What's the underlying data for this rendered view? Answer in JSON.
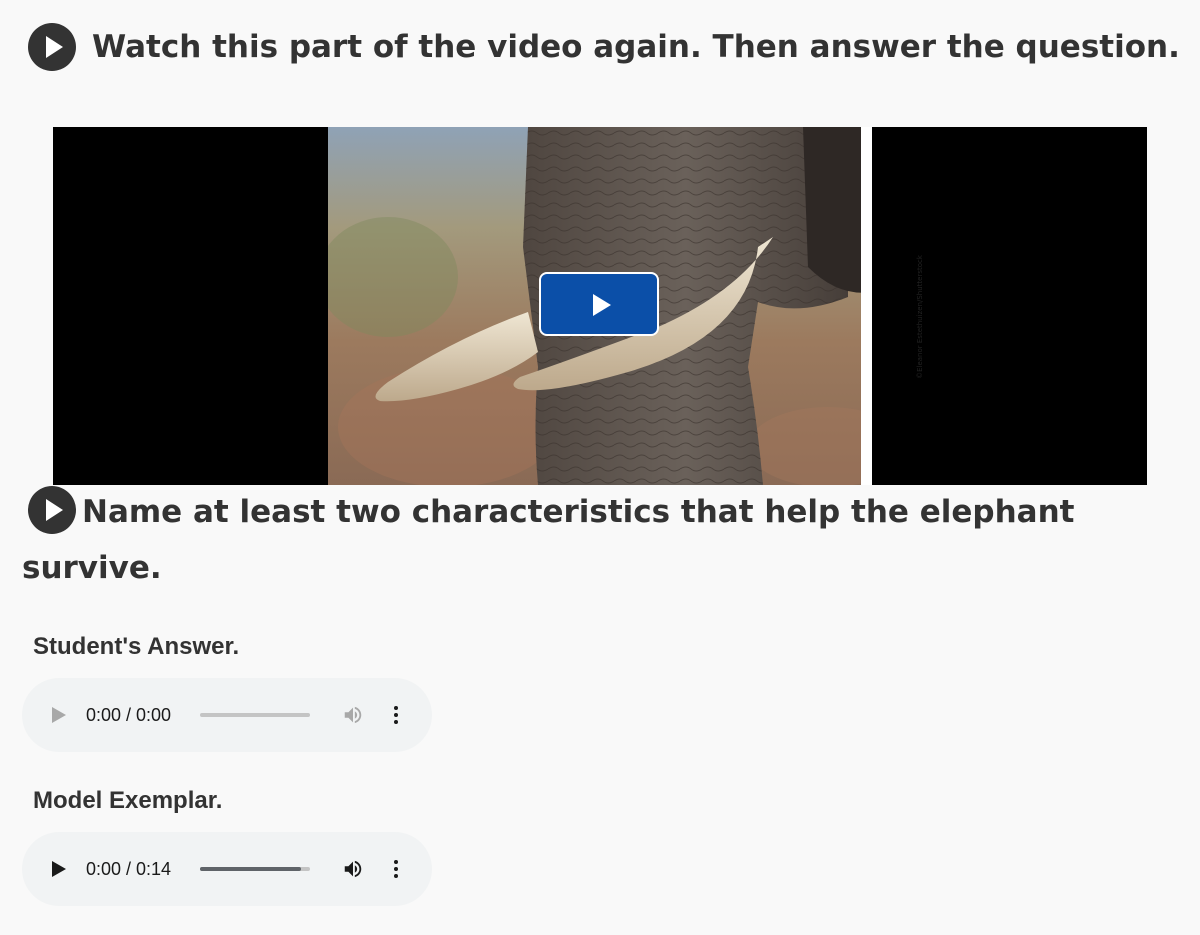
{
  "instruction": {
    "text": "Watch this part of the video again. Then answer the question.",
    "icon": "play-circle-icon"
  },
  "video": {
    "photo_credit": "©Eleanor Estethuizen/Shutterstock",
    "play_button_color": "#0b4fa8",
    "letterbox_color": "#000000"
  },
  "question": {
    "text": "Name at least two characteristics that help the elephant survive.",
    "icon": "play-circle-icon"
  },
  "student_answer": {
    "label": "Student's Answer.",
    "audio": {
      "time": "0:00 / 0:00",
      "progress": 0,
      "enabled": false
    }
  },
  "model_exemplar": {
    "label": "Model Exemplar.",
    "audio": {
      "time": "0:00 / 0:14",
      "progress": 0.92,
      "enabled": true
    }
  },
  "colors": {
    "background": "#f9f9f9",
    "text": "#333333",
    "audio_bg": "#f1f3f4"
  }
}
